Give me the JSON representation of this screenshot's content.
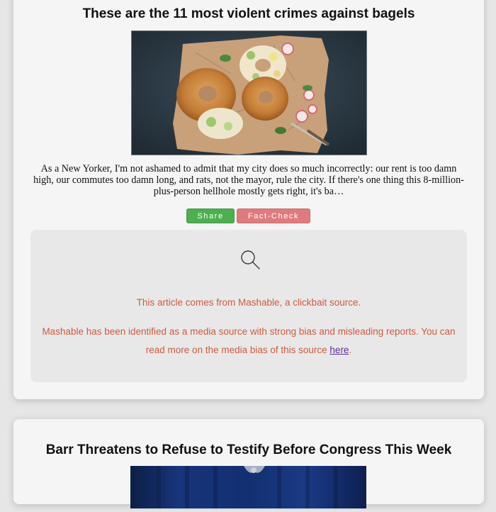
{
  "articles": [
    {
      "title": "These are the 11 most violent crimes against bagels",
      "summary": "As a New Yorker, I'm not ashamed to admit that my city does so much incorrectly: our rent is too damn high, our commutes too damn long, and rats, not the mayor, rule the city. If there's one thing this 8-million-plus-person hellhole mostly gets right, it's ba…",
      "share_label": "Share",
      "factcheck_label": "Fact-Check",
      "factcheck": {
        "icon": "search-icon",
        "source_line": "This article comes from Mashable, a clickbait source.",
        "bias_text": "Mashable has been identified as a media source with strong bias and misleading reports. You can read more on the media bias of this source ",
        "link_text": "here",
        "bias_end": "."
      }
    },
    {
      "title": "Barr Threatens to Refuse to Testify Before Congress This Week"
    }
  ],
  "colors": {
    "share": "#4caf50",
    "factcheck": "#e07b7d",
    "warning_text": "#cf5a3f",
    "link": "#5b2fa0"
  }
}
